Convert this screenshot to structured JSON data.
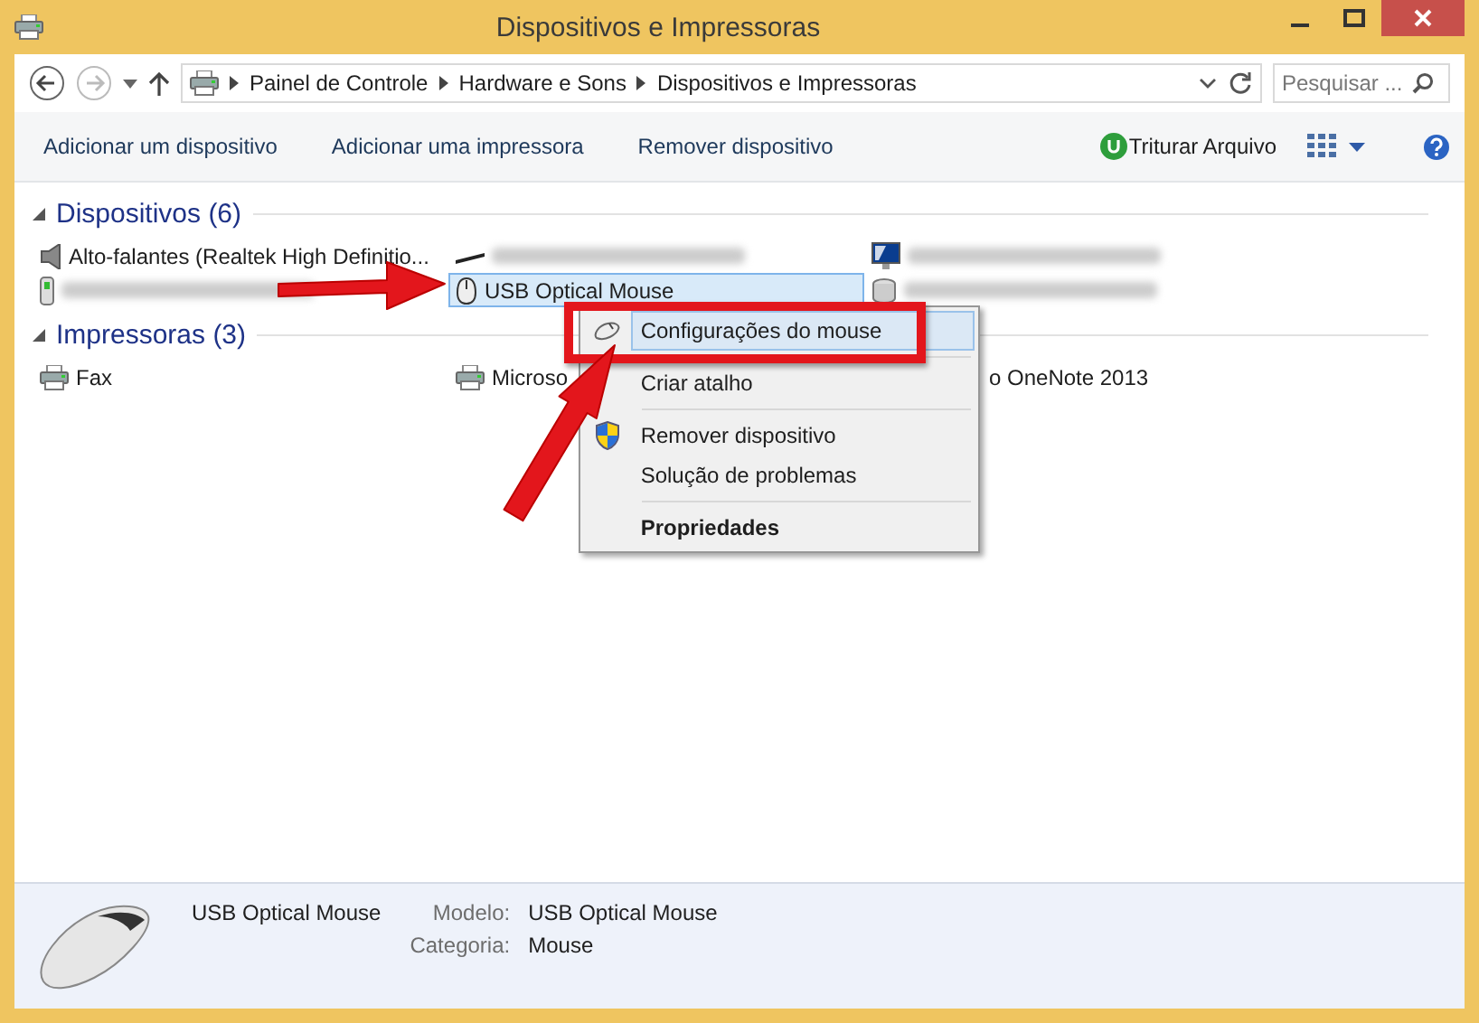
{
  "window": {
    "title": "Dispositivos e Impressoras"
  },
  "address_bar": {
    "crumbs": [
      "Painel de Controle",
      "Hardware e Sons",
      "Dispositivos e Impressoras"
    ]
  },
  "search": {
    "placeholder": "Pesquisar ..."
  },
  "command_bar": {
    "commands": [
      "Adicionar um dispositivo",
      "Adicionar uma impressora",
      "Remover dispositivo"
    ],
    "shred": "Triturar Arquivo"
  },
  "groups": [
    {
      "title": "Dispositivos (6)",
      "expanded": true,
      "items": [
        {
          "kind": "speaker",
          "label": "Alto-falantes (Realtek High Definitio...",
          "selected": false
        },
        {
          "kind": "keyboard",
          "selected": false
        },
        {
          "kind": "monitor",
          "selected": false
        },
        {
          "kind": "usb-stick",
          "selected": false
        },
        {
          "kind": "mouse",
          "label": "USB Optical Mouse",
          "selected": true
        },
        {
          "kind": "drive",
          "selected": false
        }
      ]
    },
    {
      "title": "Impressoras (3)",
      "expanded": true,
      "items": [
        {
          "kind": "printer",
          "label": "Fax",
          "selected": false
        },
        {
          "kind": "printer",
          "label": "Microso",
          "selected": false
        },
        {
          "kind": "covered",
          "label": "o OneNote 2013",
          "selected": false
        }
      ]
    }
  ],
  "context_menu": {
    "items": [
      {
        "kind": "mouse",
        "label": "Configurações do mouse",
        "selected": true,
        "default": false
      },
      {
        "kind": "separator"
      },
      {
        "kind": "item",
        "label": "Criar atalho",
        "selected": false,
        "default": false
      },
      {
        "kind": "separator"
      },
      {
        "kind": "shield",
        "label": "Remover dispositivo",
        "selected": false,
        "default": false
      },
      {
        "kind": "item",
        "label": "Solução de problemas",
        "selected": false,
        "default": false
      },
      {
        "kind": "separator"
      },
      {
        "kind": "item",
        "label": "Propriedades",
        "selected": false,
        "default": true
      }
    ]
  },
  "details": {
    "name": "USB Optical Mouse",
    "fields": [
      {
        "label": "Modelo:",
        "value": "USB Optical Mouse"
      },
      {
        "label": "Categoria:",
        "value": "Mouse"
      }
    ]
  }
}
